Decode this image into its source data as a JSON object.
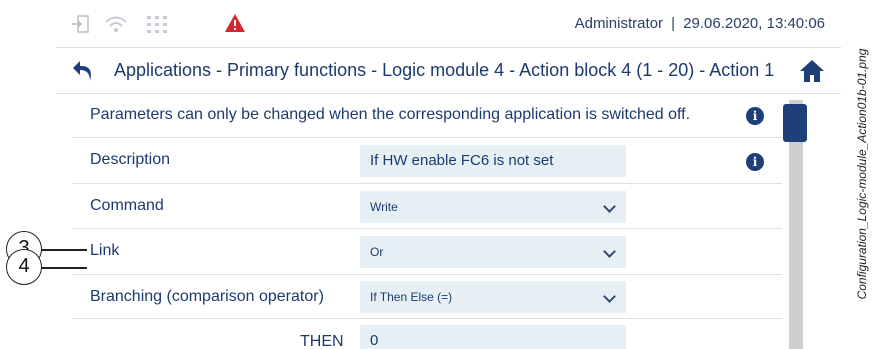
{
  "status": {
    "user": "Administrator",
    "separator": "|",
    "datetime": "29.06.2020, 13:40:06",
    "icons": [
      "login-icon",
      "wifi-icon",
      "grid-icon",
      "warning-icon"
    ],
    "warning_color": "#d8262e"
  },
  "breadcrumb": {
    "text": "Applications - Primary functions - Logic module 4 - Action block 4 (1 - 20) - Action 1"
  },
  "notice": {
    "text": "Parameters can only be changed when the corresponding application is switched off."
  },
  "form": {
    "description": {
      "label": "Description",
      "value": "If HW enable FC6 is not set"
    },
    "command": {
      "label": "Command",
      "value": "Write"
    },
    "link": {
      "label": "Link",
      "value": "Or"
    },
    "branching": {
      "label": "Branching (comparison operator)",
      "value": "If Then Else (=)"
    },
    "then": {
      "label": "THEN",
      "value": "0"
    }
  },
  "callouts": {
    "c3": "3",
    "c4": "4"
  },
  "caption": "Configuration_Logic-module_Action01b-01.png",
  "colors": {
    "accent": "#1f3f7a",
    "field_bg": "#e6f0f4"
  }
}
